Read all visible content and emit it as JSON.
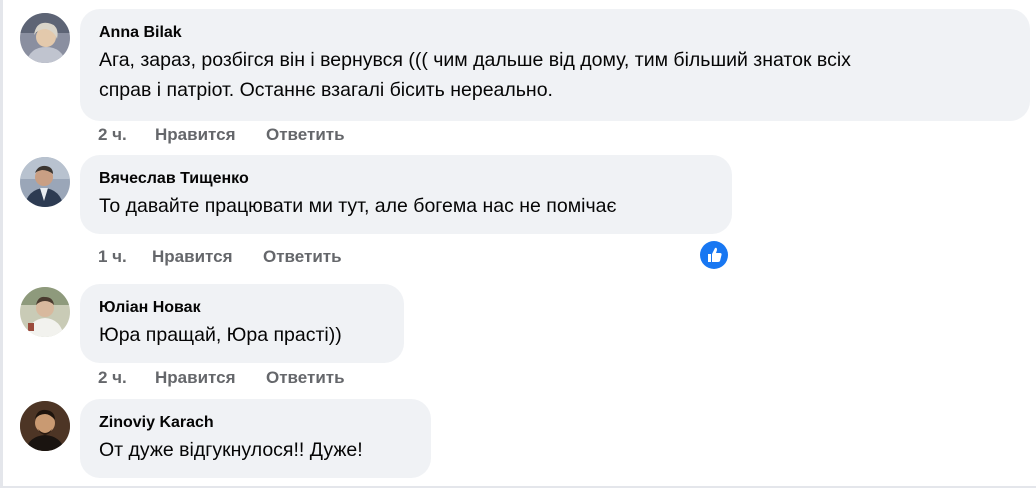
{
  "comments": [
    {
      "author": "Anna Bilak",
      "lines": [
        "Ага, зараз, розбігся він і вернувся ((( чим дальше від дому, тим більший знаток всіх",
        "справ і патріот. Останнє взагалі бісить нереально."
      ],
      "time": "2 ч.",
      "like_label": "Нравится",
      "reply_label": "Ответить"
    },
    {
      "author": "Вячеслав Тищенко",
      "lines": [
        "То давайте працювати ми тут, але богема нас не помічає"
      ],
      "time": "1 ч.",
      "like_label": "Нравится",
      "reply_label": "Ответить",
      "reaction_icon": "thumbs-up-icon"
    },
    {
      "author": "Юліан Новак",
      "lines": [
        "Юра пращай, Юра прасті))"
      ],
      "time": "2 ч.",
      "like_label": "Нравится",
      "reply_label": "Ответить"
    },
    {
      "author": "Zinoviy Karach",
      "lines": [
        "От дуже відгукнулося!! Дуже!"
      ]
    }
  ],
  "colors": {
    "bubble": "#f0f2f5",
    "meta_text": "#65676b",
    "like_blue": "#1877f2"
  }
}
